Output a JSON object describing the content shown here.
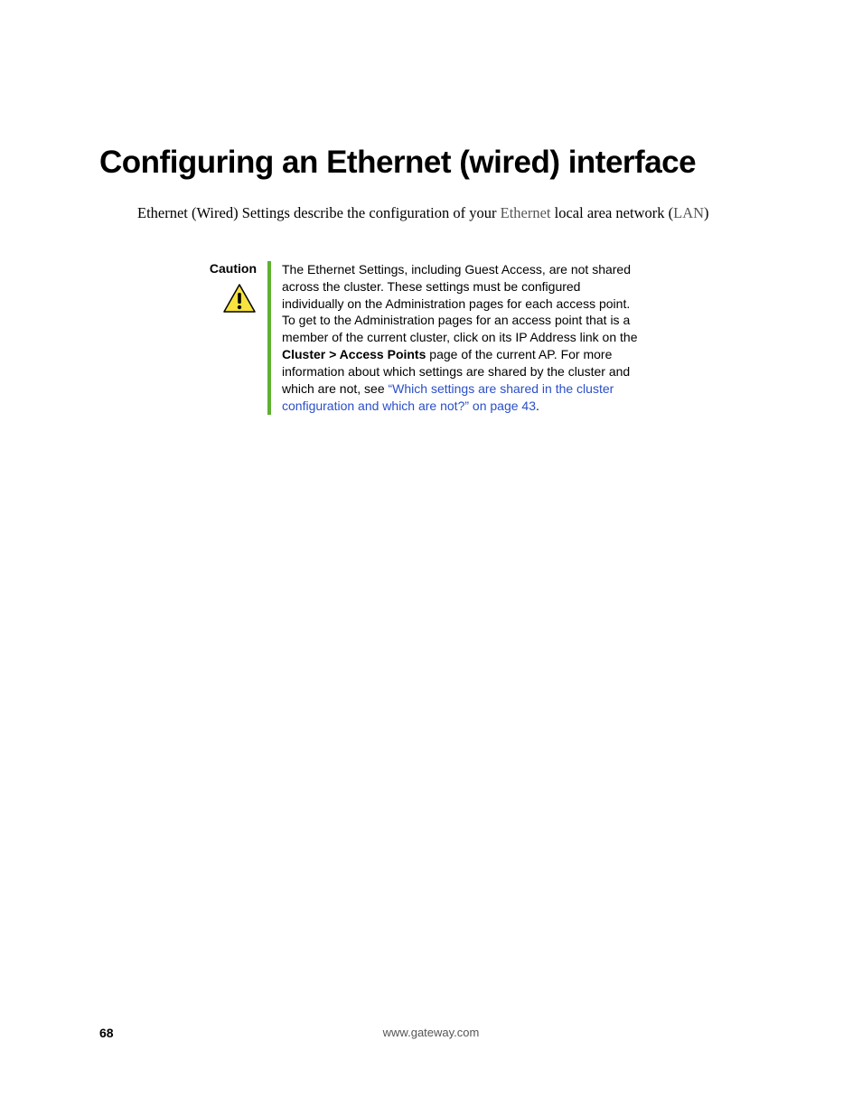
{
  "heading": "Configuring an Ethernet (wired) interface",
  "intro": {
    "part1": "Ethernet (Wired) Settings describe the configuration of your ",
    "link_word": "Ethernet",
    "part2": " local area network (",
    "lan": "LAN",
    "part3": ")"
  },
  "caution": {
    "label": "Caution",
    "body_part1": "The Ethernet Settings, including Guest Access, are not shared across the cluster. These settings must be configured individually on the Administration pages for each access point. To get to the Administration pages for an access point that is a member of the current cluster, click on its IP Address link on the ",
    "bold_part": "Cluster > Access Points",
    "body_part2": " page of the current AP. For more information about which settings are shared by the cluster and which are not, see ",
    "xref": "“Which settings are shared in the cluster configuration and which are not?” on page 43",
    "body_part3": "."
  },
  "footer": {
    "page_number": "68",
    "url": "www.gateway.com"
  }
}
